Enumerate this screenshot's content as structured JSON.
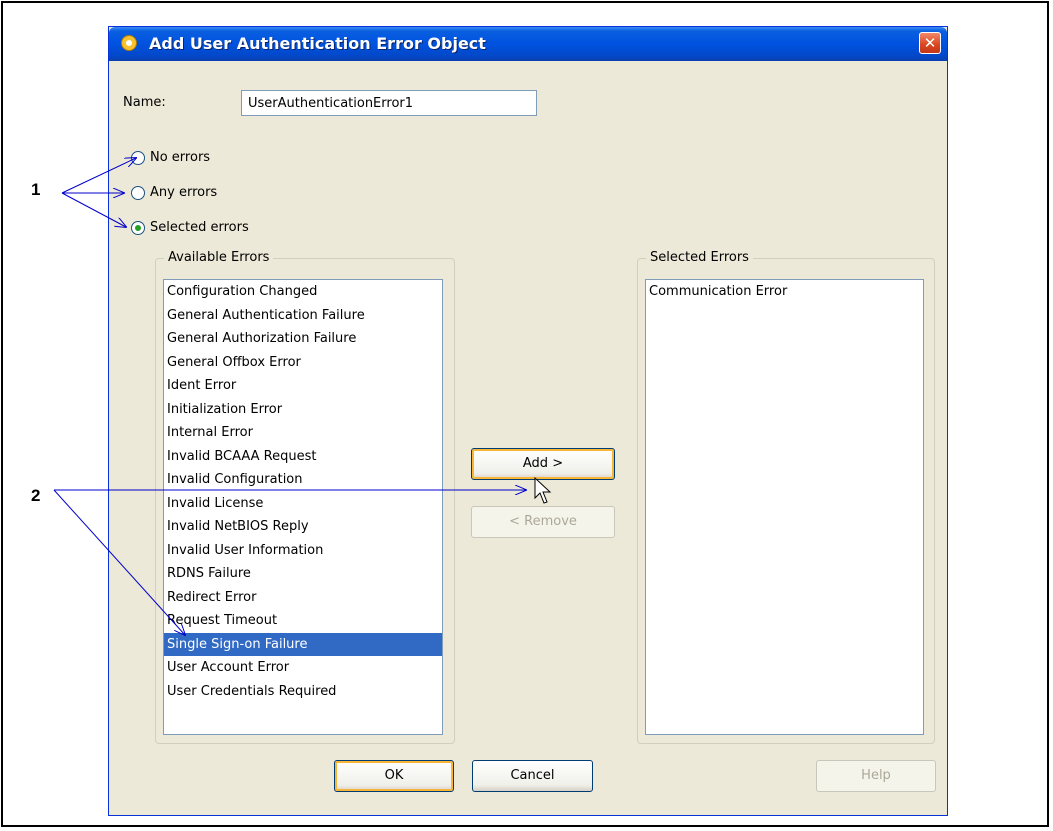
{
  "dialog": {
    "title": "Add User Authentication Error Object",
    "close_label": "✕"
  },
  "name": {
    "label": "Name:",
    "value": "UserAuthenticationError1"
  },
  "options": [
    {
      "label": "No errors",
      "checked": false
    },
    {
      "label": "Any errors",
      "checked": false
    },
    {
      "label": "Selected errors",
      "checked": true
    }
  ],
  "available": {
    "title": "Available Errors",
    "items": [
      "Configuration Changed",
      "General Authentication Failure",
      "General Authorization Failure",
      "General Offbox Error",
      "Ident Error",
      "Initialization Error",
      "Internal Error",
      "Invalid BCAAA Request",
      "Invalid Configuration",
      "Invalid License",
      "Invalid NetBIOS Reply",
      "Invalid User Information",
      "RDNS Failure",
      "Redirect Error",
      "Request Timeout",
      "Single Sign-on Failure",
      "User Account Error",
      "User Credentials Required"
    ],
    "selected_item": "Single Sign-on Failure"
  },
  "selected": {
    "title": "Selected Errors",
    "items": [
      "Communication Error"
    ]
  },
  "buttons": {
    "add": "Add >",
    "remove": "< Remove",
    "ok": "OK",
    "cancel": "Cancel",
    "help": "Help"
  },
  "callouts": {
    "one": "1",
    "two": "2"
  },
  "colors": {
    "titlebar": "#0052e0",
    "selection": "#316ac5",
    "arrow": "#0000cc"
  }
}
